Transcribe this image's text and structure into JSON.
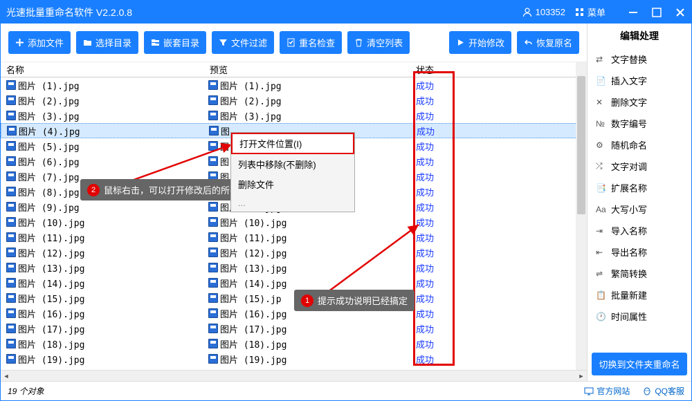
{
  "title": "光速批量重命名软件 V2.2.0.8",
  "user_id": "103352",
  "menu_label": "菜单",
  "toolbar": {
    "add_file": "添加文件",
    "select_dir": "选择目录",
    "nested_dir": "嵌套目录",
    "file_filter": "文件过滤",
    "rename_check": "重名检查",
    "clear_list": "清空列表",
    "start_modify": "开始修改",
    "restore": "恢复原名"
  },
  "columns": {
    "name": "名称",
    "preview": "预览",
    "status": "状态"
  },
  "status_success": "成功",
  "rows": [
    {
      "name": "图片 (1).jpg",
      "prev": "图片 (1).jpg"
    },
    {
      "name": "图片 (2).jpg",
      "prev": "图片 (2).jpg"
    },
    {
      "name": "图片 (3).jpg",
      "prev": "图片 (3).jpg"
    },
    {
      "name": "图片 (4).jpg",
      "prev": "图",
      "selected": true
    },
    {
      "name": "图片 (5).jpg",
      "prev": "图"
    },
    {
      "name": "图片 (6).jpg",
      "prev": "图"
    },
    {
      "name": "图片 (7).jpg",
      "prev": "图"
    },
    {
      "name": "图片 (8).jpg",
      "prev": "图"
    },
    {
      "name": "图片 (9).jpg",
      "prev": "图片 (9).jpg"
    },
    {
      "name": "图片 (10).jpg",
      "prev": "图片 (10).jpg"
    },
    {
      "name": "图片 (11).jpg",
      "prev": "图片 (11).jpg"
    },
    {
      "name": "图片 (12).jpg",
      "prev": "图片 (12).jpg"
    },
    {
      "name": "图片 (13).jpg",
      "prev": "图片 (13).jpg"
    },
    {
      "name": "图片 (14).jpg",
      "prev": "图片 (14).jpg"
    },
    {
      "name": "图片 (15).jpg",
      "prev": "图片 (15).jp"
    },
    {
      "name": "图片 (16).jpg",
      "prev": "图片 (16).jpg"
    },
    {
      "name": "图片 (17).jpg",
      "prev": "图片 (17).jpg"
    },
    {
      "name": "图片 (18).jpg",
      "prev": "图片 (18).jpg"
    },
    {
      "name": "图片 (19).jpg",
      "prev": "图片 (19).jpg"
    }
  ],
  "context_menu": {
    "open_location": "打开文件位置(I)",
    "remove_from_list": "列表中移除(不删除)",
    "delete_file": "删除文件"
  },
  "side": {
    "title": "编辑处理",
    "items": [
      "文字替换",
      "插入文字",
      "删除文字",
      "数字编号",
      "随机命名",
      "文字对调",
      "扩展名称",
      "大写小写",
      "导入名称",
      "导出名称",
      "繁简转换",
      "批量新建",
      "时间属性"
    ],
    "switch_btn": "切换到文件夹重命名"
  },
  "callouts": {
    "c1": "提示成功说明已经搞定",
    "c2": "鼠标右击，可以打开修改后的所有文件"
  },
  "status": {
    "count": "19 个对象",
    "official": "官方网站",
    "qq": "QQ客服"
  }
}
